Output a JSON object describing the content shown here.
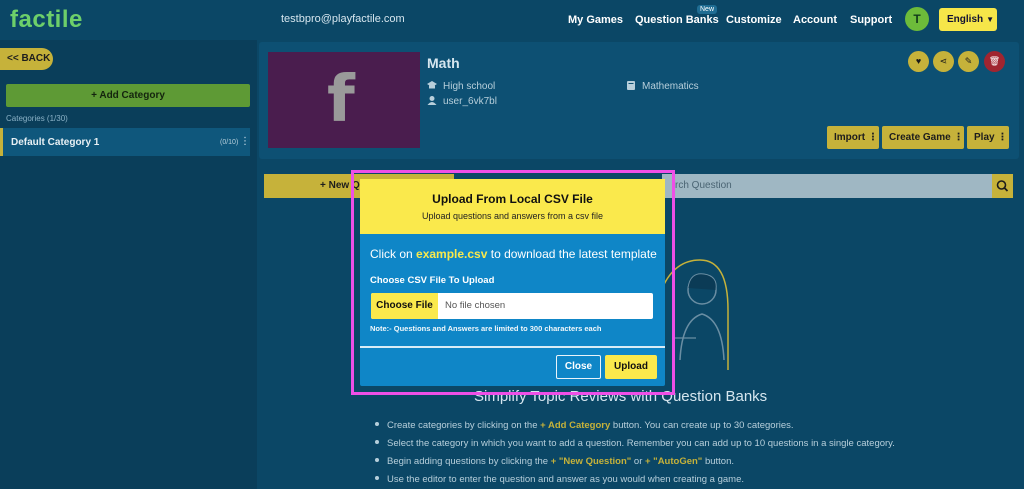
{
  "header": {
    "logo": "factile",
    "email": "testbpro@playfactile.com",
    "nav": [
      {
        "label": "My Games"
      },
      {
        "label": "Question Banks"
      },
      {
        "label": "Customize"
      },
      {
        "label": "Account"
      },
      {
        "label": "Support"
      }
    ],
    "new_badge": "New",
    "avatar_initial": "T",
    "language": "English"
  },
  "sidebar": {
    "back_label": "<< BACK",
    "add_category_label": "Add Category",
    "categories_count": "Categories  (1/30)",
    "categories": [
      {
        "name": "Default Category 1",
        "count": "(0/10)"
      }
    ]
  },
  "bank": {
    "title": "Math",
    "thumb_letter": "f",
    "level": "High school",
    "owner": "user_6vk7bl",
    "subject": "Mathematics",
    "actions": [
      {
        "label": "Import"
      },
      {
        "label": "Create Game"
      },
      {
        "label": "Play"
      }
    ]
  },
  "toolbar": {
    "new_question_label": "New Q",
    "search_placeholder": "rch Question"
  },
  "content": {
    "heading": "Simplify Topic Reviews with Question Banks",
    "bullets": [
      {
        "pre": "Create categories by clicking on the ",
        "hl": "+ Add Category",
        "post": " button. You can create up to 30 categories."
      },
      {
        "pre": "Select the category in which you want to add a question. Remember you can add up to 10 questions in a single category.",
        "hl": "",
        "post": ""
      },
      {
        "pre": "Begin adding questions by clicking the ",
        "hl": "+ \"New Question\"",
        "mid": " or ",
        "hl2": "+ \"AutoGen\"",
        "post": " button."
      },
      {
        "pre": "Use the editor to enter the question and answer as you would when creating a game.",
        "hl": "",
        "post": ""
      }
    ]
  },
  "modal": {
    "title": "Upload From Local CSV File",
    "subtitle": "Upload questions and answers from a csv file",
    "download_pre": "Click on ",
    "download_link": "example.csv",
    "download_post": " to download the latest template",
    "choose_label": "Choose CSV File To Upload",
    "file_button": "Choose File",
    "file_status": "No file chosen",
    "note": "Note:- Questions and Answers are limited to 300 characters each",
    "close_label": "Close",
    "upload_label": "Upload"
  },
  "colors": {
    "accent_yellow": "#fae94c",
    "modal_blue": "#0f86c7",
    "highlight_magenta": "#ee4fe7"
  }
}
